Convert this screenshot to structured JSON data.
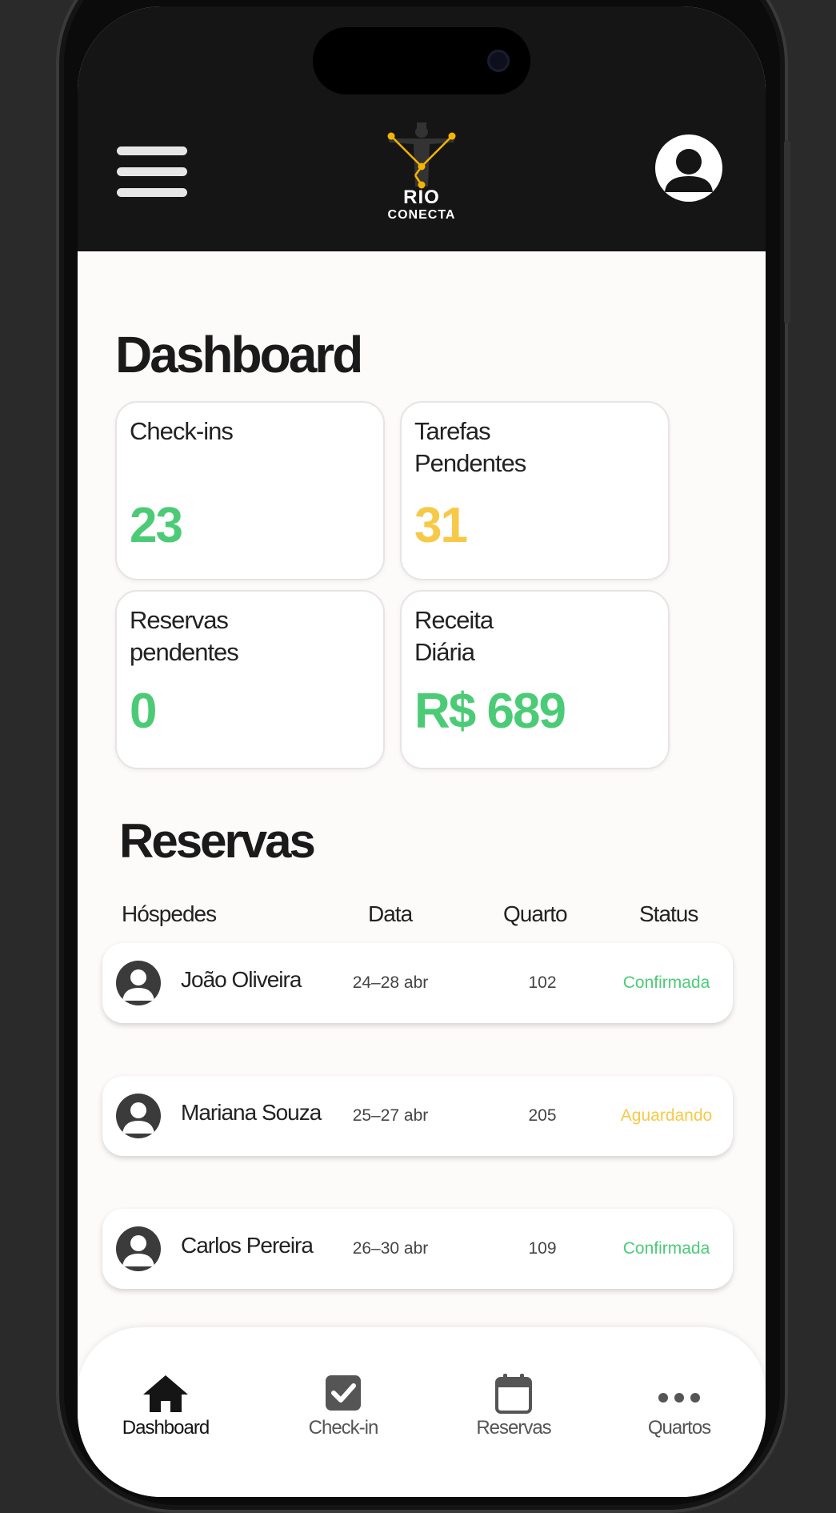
{
  "header": {
    "logo_line1": "RIO",
    "logo_line2": "CONECTA"
  },
  "page_title": "Dashboard",
  "stats": [
    {
      "label": "Check-ins",
      "value": "23",
      "color": "#4ccb77"
    },
    {
      "label": "Tarefas Pendentes",
      "value": "31",
      "color": "#f7c948"
    },
    {
      "label": "Reservas pendentes",
      "value": "0",
      "color": "#4ccb77"
    },
    {
      "label": "Receita Diária",
      "value": "R$ 689",
      "color": "#4ccb77"
    }
  ],
  "reservations": {
    "title": "Reservas",
    "columns": [
      "Hóspedes",
      "Data",
      "Quarto",
      "Status"
    ],
    "rows": [
      {
        "guest": "João Oliveira",
        "date": "24–28 abr",
        "room": "102",
        "status": "Confirmada",
        "status_color": "#4ccb77"
      },
      {
        "guest": "Mariana Souza",
        "date": "25–27 abr",
        "room": "205",
        "status": "Aguardando",
        "status_color": "#f7c948"
      },
      {
        "guest": "Carlos Pereira",
        "date": "26–30 abr",
        "room": "109",
        "status": "Confirmada",
        "status_color": "#4ccb77"
      }
    ]
  },
  "nav": [
    {
      "label": "Dashboard",
      "icon": "home-icon",
      "active": true
    },
    {
      "label": "Check-in",
      "icon": "checkbox-icon",
      "active": false
    },
    {
      "label": "Reservas",
      "icon": "calendar-icon",
      "active": false
    },
    {
      "label": "Quartos",
      "icon": "more-icon",
      "active": false
    }
  ],
  "colors": {
    "header_bg": "#151515",
    "accent_green": "#4ccb77",
    "accent_yellow": "#f7c948",
    "logo_accent": "#f5b400"
  }
}
